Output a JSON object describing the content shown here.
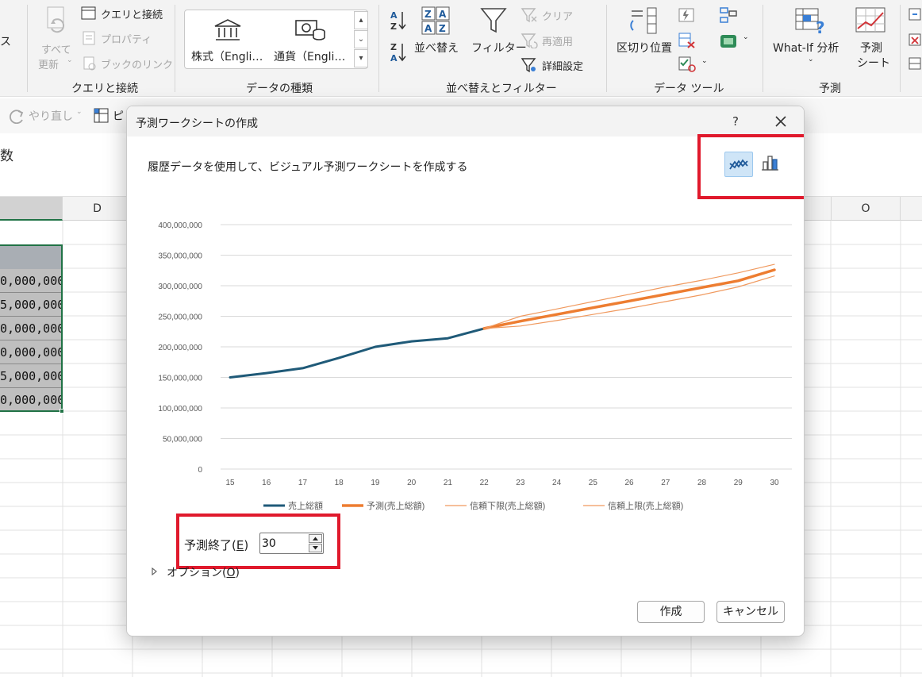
{
  "ribbon": {
    "refresh_all": {
      "line1": "すべて",
      "line2": "更新"
    },
    "queries_connections": "クエリと接続",
    "properties": "プロパティ",
    "workbook_links": "ブックのリンク",
    "query_group_label": "クエリと接続",
    "stocks": "株式（Engli…",
    "currencies": "通貨（Engli…",
    "data_types_label": "データの種類",
    "sort": "並べ替え",
    "filter": "フィルター",
    "clear": "クリア",
    "reapply": "再適用",
    "advanced": "詳細設定",
    "sort_filter_label": "並べ替えとフィルター",
    "text_to_columns": "区切り位置",
    "data_tools_label": "データ ツール",
    "what_if": "What-If 分析",
    "forecast_sheet": {
      "line1": "予測",
      "line2": "シート"
    },
    "forecast_label": "予測",
    "left_cut": "ス"
  },
  "qat": {
    "redo": "やり直し",
    "pivot_cut": "ピ"
  },
  "fx_cut": "数",
  "sheet": {
    "columns": [
      "D",
      "O"
    ],
    "values": [
      "0,000,000",
      "5,000,000",
      "0,000,000",
      "0,000,000",
      "5,000,000",
      "0,000,000"
    ]
  },
  "dialog": {
    "title": "予測ワークシートの作成",
    "help": "?",
    "description": "履歴データを使用して、ビジュアル予測ワークシートを作成する",
    "forecast_end_label": "予測終了(",
    "forecast_end_key": "E",
    "forecast_end_close": ")",
    "forecast_end_value": "30",
    "options_label": "オプション(",
    "options_key": "O",
    "options_close": ")",
    "create_button": "作成",
    "cancel_button": "キャンセル",
    "active_chart_type": "line"
  },
  "colors": {
    "history": "#1f5a78",
    "forecast": "#ed7d31",
    "highlight": "#e0192c",
    "gridline": "#d9d9d9"
  },
  "chart_data": {
    "type": "line",
    "title": "",
    "xlabel": "",
    "ylabel": "",
    "ylim": [
      0,
      400000000
    ],
    "yticks": [
      0,
      50000000,
      100000000,
      150000000,
      200000000,
      250000000,
      300000000,
      350000000,
      400000000
    ],
    "ytick_labels": [
      "0",
      "50,000,000",
      "100,000,000",
      "150,000,000",
      "200,000,000",
      "250,000,000",
      "300,000,000",
      "350,000,000",
      "400,000,000"
    ],
    "x": [
      15,
      16,
      17,
      18,
      19,
      20,
      21,
      22,
      23,
      24,
      25,
      26,
      27,
      28,
      29,
      30
    ],
    "grid": true,
    "legend_position": "bottom",
    "series": [
      {
        "name": "売上総額",
        "color": "#1f5a78",
        "width": 3,
        "x": [
          15,
          16,
          17,
          18,
          19,
          20,
          21,
          22
        ],
        "values": [
          150000000,
          157000000,
          165000000,
          182000000,
          200000000,
          209000000,
          214000000,
          230000000
        ]
      },
      {
        "name": "予測(売上総額)",
        "color": "#ed7d31",
        "width": 3.5,
        "x": [
          22,
          23,
          24,
          25,
          26,
          27,
          28,
          29,
          30
        ],
        "values": [
          230000000,
          242000000,
          253000000,
          264000000,
          275000000,
          286000000,
          297000000,
          308000000,
          326000000
        ]
      },
      {
        "name": "信頼下限(売上総額)",
        "color": "#f0995e",
        "width": 1.2,
        "x": [
          22,
          23,
          24,
          25,
          26,
          27,
          28,
          29,
          30
        ],
        "values": [
          230000000,
          234000000,
          243000000,
          253000000,
          263000000,
          274000000,
          285000000,
          298000000,
          316000000
        ]
      },
      {
        "name": "信頼上限(売上総額)",
        "color": "#f0995e",
        "width": 1.2,
        "x": [
          22,
          23,
          24,
          25,
          26,
          27,
          28,
          29,
          30
        ],
        "values": [
          230000000,
          250000000,
          262000000,
          274000000,
          286000000,
          298000000,
          309000000,
          321000000,
          335000000
        ]
      }
    ]
  }
}
